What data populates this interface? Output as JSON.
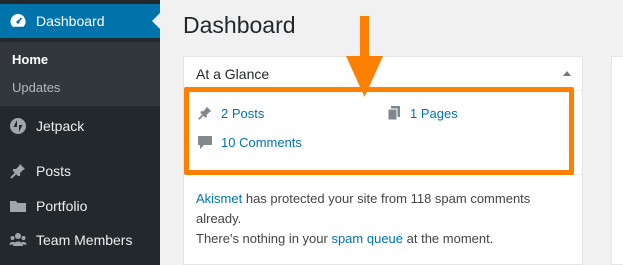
{
  "sidebar": {
    "items": [
      {
        "label": "Dashboard",
        "icon": "dashboard-icon"
      },
      {
        "label": "Jetpack",
        "icon": "jetpack-icon"
      },
      {
        "label": "Posts",
        "icon": "pin-icon"
      },
      {
        "label": "Portfolio",
        "icon": "folder-icon"
      },
      {
        "label": "Team Members",
        "icon": "team-icon"
      }
    ],
    "submenu": [
      {
        "label": "Home"
      },
      {
        "label": "Updates"
      }
    ]
  },
  "main": {
    "title": "Dashboard",
    "widget": {
      "title": "At a Glance",
      "posts": "2 Posts",
      "pages": "1 Pages",
      "comments": "10 Comments",
      "akismet_link": "Akismet",
      "akismet_text": " has protected your site from 118 spam comments already.",
      "spam_prefix": "There's nothing in your ",
      "spam_link": "spam queue",
      "spam_suffix": " at the moment."
    }
  },
  "colors": {
    "sidebar_bg": "#23282d",
    "active": "#0073aa",
    "highlight": "#ff7f00",
    "link": "#0073aa"
  }
}
